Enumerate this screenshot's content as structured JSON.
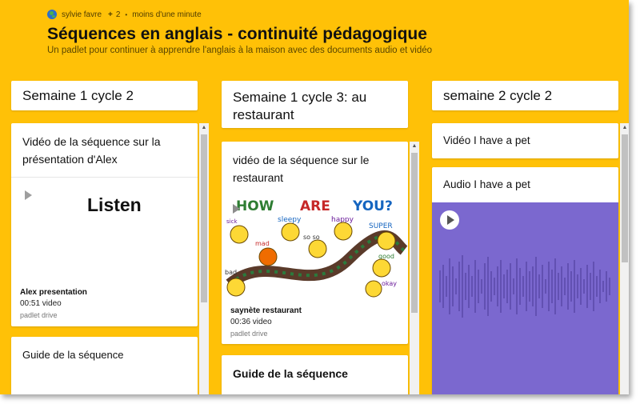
{
  "header": {
    "author": "sylvie favre",
    "plus": "+",
    "contributors": "2",
    "separator": "•",
    "updated": "moins d'une minute",
    "title": "Séquences en anglais - continuité pédagogique",
    "subtitle": "Un padlet pour continuer à apprendre l'anglais à la maison avec des documents audio et vidéo"
  },
  "columns": [
    {
      "title": "Semaine 1 cycle 2",
      "cards": [
        {
          "title": "Vidéo de la séquence sur la présentation d'Alex",
          "preview_text": "Listen",
          "attachment": {
            "title": "Alex presentation",
            "meta": "00:51 video",
            "source": "padlet drive"
          }
        },
        {
          "title": "Guide de la séquence"
        }
      ]
    },
    {
      "title": "Semaine  1 cycle 3: au restaurant",
      "cards": [
        {
          "title": "vidéo de la séquence sur le restaurant",
          "image_words": [
            "HOW",
            "ARE",
            "YOU?",
            "sleepy",
            "happy",
            "SUPER",
            "so so",
            "mad",
            "sick",
            "good",
            "bad",
            "okay"
          ],
          "attachment": {
            "title": "saynète restaurant",
            "meta": "00:36 video",
            "source": "padlet drive"
          }
        },
        {
          "title": "Guide de la séquence"
        }
      ]
    },
    {
      "title": "semaine 2 cycle 2",
      "cards": [
        {
          "title": "Vidéo I have a pet"
        },
        {
          "title": "Audio I have a pet"
        }
      ]
    }
  ],
  "colors": {
    "background": "#ffc107",
    "audio": "#7b68cf",
    "card": "#ffffff"
  },
  "icons": [
    "globe-icon",
    "play-icon",
    "scroll-up-icon"
  ]
}
